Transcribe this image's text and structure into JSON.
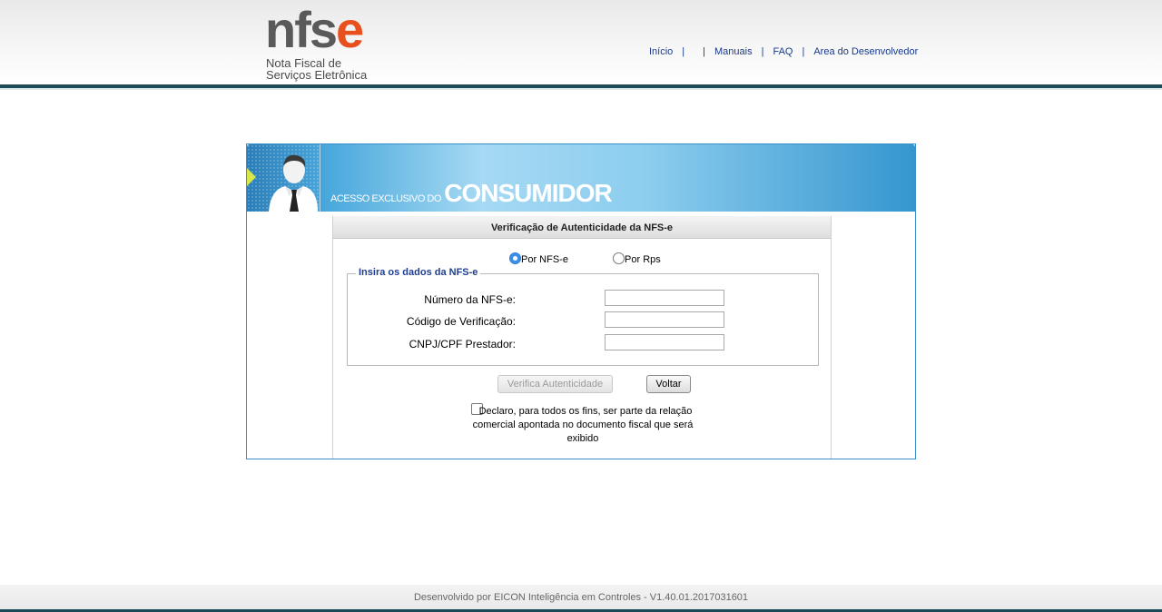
{
  "header": {
    "logo": {
      "nfs": "nfs",
      "e": "e",
      "subtitle_line1": "Nota Fiscal de",
      "subtitle_line2": "Serviços Eletrônica"
    },
    "nav": [
      {
        "label": "Início"
      },
      {
        "label": ""
      },
      {
        "label": "Manuais"
      },
      {
        "label": "FAQ"
      },
      {
        "label": "Area do Desenvolvedor"
      }
    ],
    "nav_separator": "|"
  },
  "banner": {
    "small_text": "ACESSO EXCLUSIVO DO",
    "big_text": "CONSUMIDOR"
  },
  "form": {
    "title": "Verificação de Autenticidade da NFS-e",
    "radios": [
      {
        "label": "Por NFS-e",
        "checked": true
      },
      {
        "label": "Por Rps",
        "checked": false
      }
    ],
    "legend": "Insira os dados da NFS-e",
    "fields": [
      {
        "label": "Número da NFS-e:",
        "value": ""
      },
      {
        "label": "Código de Verificação:",
        "value": ""
      },
      {
        "label": "CNPJ/CPF Prestador:",
        "value": ""
      }
    ],
    "verify_button": "Verifica Autenticidade",
    "back_button": "Voltar",
    "declaration": "Declaro, para todos os fins, ser parte da relação comercial apontada no documento fiscal que será exibido",
    "declaration_checked": false
  },
  "footer": {
    "text": "Desenvolvido por EICON Inteligência em Controles - V1.40.01.2017031601"
  },
  "colors": {
    "header_line": "#1d4a57",
    "logo_accent": "#e8501e",
    "link": "#1a3a8a",
    "legend": "#1e3f8f",
    "panel_border": "#3a8fc9"
  }
}
